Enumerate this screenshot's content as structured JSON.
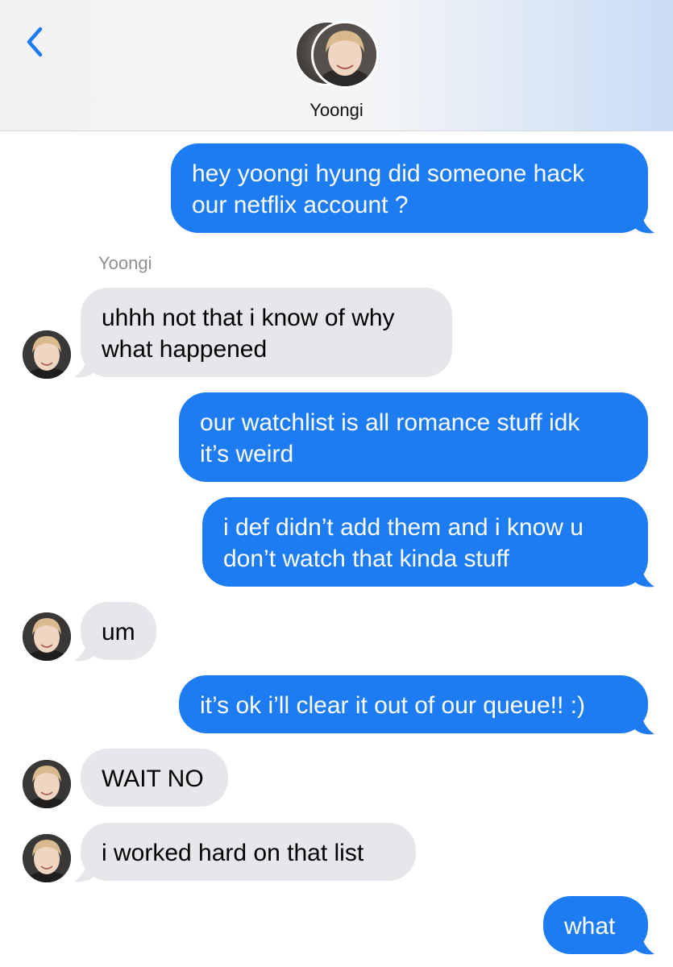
{
  "contact": {
    "name": "Yoongi"
  },
  "thread": {
    "sender_label": "Yoongi"
  },
  "messages": [
    {
      "from": "me",
      "lines": [
        "hey yoongi hyung did someone hack",
        "our netflix account ?"
      ]
    },
    {
      "from": "them",
      "lines": [
        "uhhh not that i know of why",
        "what happened"
      ]
    },
    {
      "from": "me",
      "lines": [
        "our watchlist is all romance stuff idk",
        "it’s weird"
      ]
    },
    {
      "from": "me",
      "lines": [
        "i def didn’t add them and i know u",
        "don’t watch that kinda stuff"
      ]
    },
    {
      "from": "them",
      "lines": [
        "um"
      ]
    },
    {
      "from": "me",
      "lines": [
        "it’s ok i’ll clear it out of our queue!! :)"
      ]
    },
    {
      "from": "them",
      "lines": [
        "WAIT NO"
      ]
    },
    {
      "from": "them",
      "lines": [
        "i worked hard on that list"
      ]
    },
    {
      "from": "me",
      "lines": [
        "what"
      ]
    }
  ],
  "colors": {
    "outgoing": "#1d7cf2",
    "incoming": "#e6e6eb",
    "accent": "#1d7cf2"
  },
  "icons": {
    "back": "chevron-left-icon"
  }
}
